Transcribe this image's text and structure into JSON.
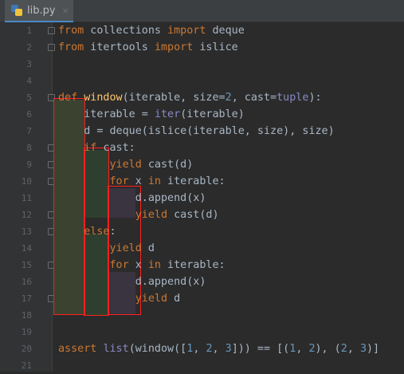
{
  "tab": {
    "filename": "lib.py",
    "close_symbol": "×",
    "icon": "python-file-icon"
  },
  "line_numbers": [
    "1",
    "2",
    "3",
    "4",
    "5",
    "6",
    "7",
    "8",
    "9",
    "10",
    "11",
    "12",
    "13",
    "14",
    "15",
    "16",
    "17",
    "18",
    "19",
    "20",
    "21"
  ],
  "code": [
    [
      {
        "t": "from",
        "c": "kw"
      },
      {
        "t": " collections ",
        "c": ""
      },
      {
        "t": "import",
        "c": "kw"
      },
      {
        "t": " deque",
        "c": ""
      }
    ],
    [
      {
        "t": "from",
        "c": "kw"
      },
      {
        "t": " itertools ",
        "c": ""
      },
      {
        "t": "import",
        "c": "kw"
      },
      {
        "t": " islice",
        "c": ""
      }
    ],
    [],
    [],
    [
      {
        "t": "def",
        "c": "kw"
      },
      {
        "t": " ",
        "c": ""
      },
      {
        "t": "window",
        "c": "fn"
      },
      {
        "t": "(iterable, size=",
        "c": ""
      },
      {
        "t": "2",
        "c": "num"
      },
      {
        "t": ", cast=",
        "c": ""
      },
      {
        "t": "tuple",
        "c": "bi"
      },
      {
        "t": "):",
        "c": ""
      }
    ],
    [
      {
        "t": "    iterable = ",
        "c": ""
      },
      {
        "t": "iter",
        "c": "bi"
      },
      {
        "t": "(iterable)",
        "c": ""
      }
    ],
    [
      {
        "t": "    d = deque(islice(iterable, size), size)",
        "c": ""
      }
    ],
    [
      {
        "t": "    ",
        "c": ""
      },
      {
        "t": "if",
        "c": "kw"
      },
      {
        "t": " cast:",
        "c": ""
      }
    ],
    [
      {
        "t": "        ",
        "c": ""
      },
      {
        "t": "yield",
        "c": "kw"
      },
      {
        "t": " cast(d)",
        "c": ""
      }
    ],
    [
      {
        "t": "        ",
        "c": ""
      },
      {
        "t": "for",
        "c": "kw"
      },
      {
        "t": " x ",
        "c": ""
      },
      {
        "t": "in",
        "c": "kw"
      },
      {
        "t": " iterable:",
        "c": ""
      }
    ],
    [
      {
        "t": "            d.append(x)",
        "c": ""
      }
    ],
    [
      {
        "t": "            ",
        "c": ""
      },
      {
        "t": "yield",
        "c": "kw"
      },
      {
        "t": " cast(d)",
        "c": ""
      }
    ],
    [
      {
        "t": "    ",
        "c": ""
      },
      {
        "t": "else",
        "c": "kw"
      },
      {
        "t": ":",
        "c": ""
      }
    ],
    [
      {
        "t": "        ",
        "c": ""
      },
      {
        "t": "yield",
        "c": "kw"
      },
      {
        "t": " d",
        "c": ""
      }
    ],
    [
      {
        "t": "        ",
        "c": ""
      },
      {
        "t": "for",
        "c": "kw"
      },
      {
        "t": " x ",
        "c": ""
      },
      {
        "t": "in",
        "c": "kw"
      },
      {
        "t": " iterable:",
        "c": ""
      }
    ],
    [
      {
        "t": "            d.append(x)",
        "c": ""
      }
    ],
    [
      {
        "t": "            ",
        "c": ""
      },
      {
        "t": "yield",
        "c": "kw"
      },
      {
        "t": " d",
        "c": ""
      }
    ],
    [],
    [],
    [
      {
        "t": "assert",
        "c": "kw"
      },
      {
        "t": " ",
        "c": ""
      },
      {
        "t": "list",
        "c": "bi"
      },
      {
        "t": "(window([",
        "c": ""
      },
      {
        "t": "1",
        "c": "num"
      },
      {
        "t": ", ",
        "c": ""
      },
      {
        "t": "2",
        "c": "num"
      },
      {
        "t": ", ",
        "c": ""
      },
      {
        "t": "3",
        "c": "num"
      },
      {
        "t": "])) == [(",
        "c": ""
      },
      {
        "t": "1",
        "c": "num"
      },
      {
        "t": ", ",
        "c": ""
      },
      {
        "t": "2",
        "c": "num"
      },
      {
        "t": "), (",
        "c": ""
      },
      {
        "t": "2",
        "c": "num"
      },
      {
        "t": ", ",
        "c": ""
      },
      {
        "t": "3",
        "c": "num"
      },
      {
        "t": ")]",
        "c": ""
      }
    ],
    []
  ],
  "colors": {
    "background": "#2b2b2b",
    "keyword": "#cc7832",
    "function": "#ffc66d",
    "number": "#6897bb",
    "builtin": "#8888c6",
    "text": "#a9b7c6",
    "scope_highlight_1": "#3b4230",
    "scope_highlight_2": "#2f3f2f",
    "scope_highlight_3": "#3a3340",
    "scope_outline": "#ff2020"
  }
}
